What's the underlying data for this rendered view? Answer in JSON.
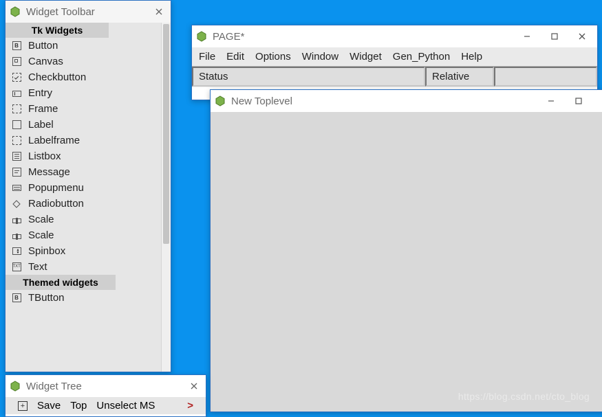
{
  "toolbar_window": {
    "title": "Widget Toolbar",
    "sections": [
      {
        "header": "Tk Widgets",
        "items": [
          "Button",
          "Canvas",
          "Checkbutton",
          "Entry",
          "Frame",
          "Label",
          "Labelframe",
          "Listbox",
          "Message",
          "Popupmenu",
          "Radiobutton",
          "Scale",
          "Scale",
          "Spinbox",
          "Text"
        ]
      },
      {
        "header": "Themed widgets",
        "items": [
          "TButton"
        ]
      }
    ]
  },
  "page_window": {
    "title": "PAGE*",
    "menu": [
      "File",
      "Edit",
      "Options",
      "Window",
      "Widget",
      "Gen_Python",
      "Help"
    ],
    "status_left": "Status",
    "status_right": "Relative"
  },
  "toplevel_window": {
    "title": "New Toplevel"
  },
  "tree_window": {
    "title": "Widget Tree",
    "buttons": [
      "Save",
      "Top",
      "Unselect MS"
    ]
  },
  "icons": {
    "Button": "B",
    "Canvas": "canvas",
    "Checkbutton": "check",
    "Entry": "entry",
    "Frame": "dashed",
    "Label": "solid",
    "Labelframe": "dashed",
    "Listbox": "list",
    "Message": "msg",
    "Popupmenu": "menu",
    "Radiobutton": "radio",
    "Scale": "scale",
    "Spinbox": "spin",
    "Text": "text",
    "TButton": "B"
  },
  "watermark": "https://blog.csdn.net/cto_blog"
}
